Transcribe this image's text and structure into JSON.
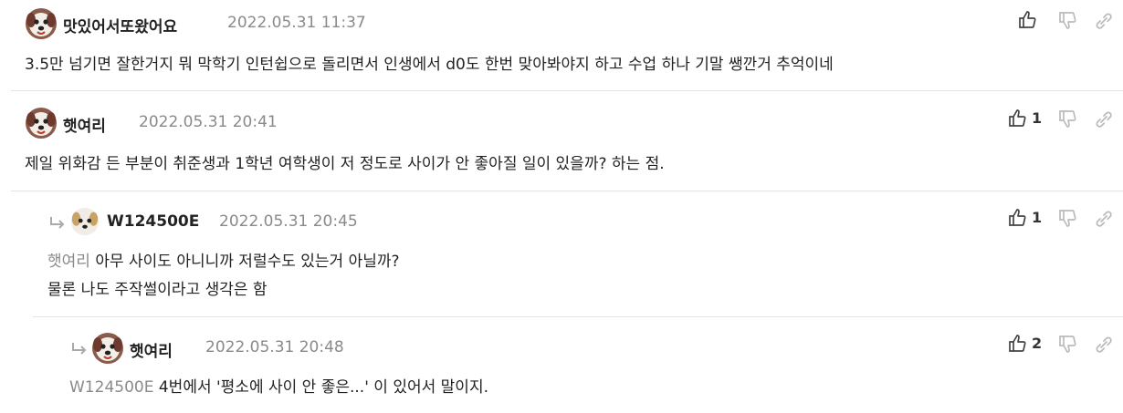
{
  "comments": [
    {
      "nickname": "맛있어서또왔어요",
      "date": "2022.05.31 11:37",
      "lines": [
        "3.5만 넘기면 잘한거지 뭐 막학기 인턴쉽으로 돌리면서 인생에서 d0도 한번 맞아봐야지 하고 수업 하나 기말 쌩깐거 추억이네"
      ],
      "likes": ""
    },
    {
      "nickname": "햇여리",
      "date": "2022.05.31 20:41",
      "lines": [
        "제일 위화감 든 부분이 취준생과 1학년 여학생이 저 정도로 사이가 안 좋아질 일이 있을까? 하는 점."
      ],
      "likes": "1"
    },
    {
      "nickname": "W124500E",
      "date": "2022.05.31 20:45",
      "mention": "햇여리",
      "lines": [
        "아무 사이도 아니니까 저럴수도 있는거 아닐까?",
        "물론 나도 주작썰이라고 생각은 함"
      ],
      "likes": "1"
    },
    {
      "nickname": "햇여리",
      "date": "2022.05.31 20:48",
      "mention": "W124500E",
      "lines": [
        "4번에서 '평소에 사이 안 좋은...' 이 있어서 말이지."
      ],
      "likes": "2"
    }
  ],
  "icons": {
    "like": "thumbs-up-icon",
    "dislike": "thumbs-down-icon",
    "link": "link-icon",
    "reply": "reply-arrow-icon",
    "avatar": "dog-avatar"
  },
  "colors": {
    "text": "#222222",
    "muted": "#8a8a8a",
    "divider": "#e4e4e4",
    "icon": "#444444",
    "icon_disabled": "#bbbbbb"
  }
}
